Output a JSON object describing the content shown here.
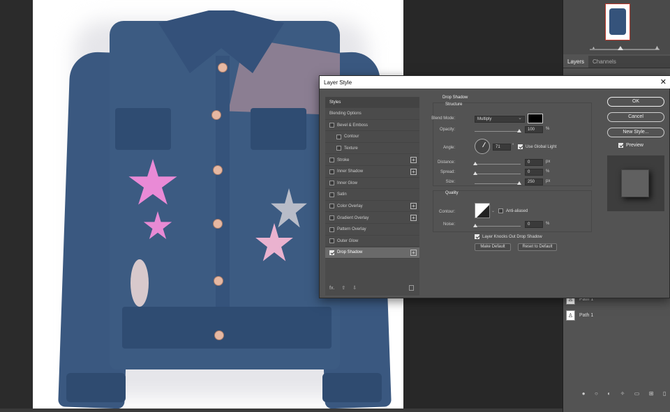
{
  "panels": {
    "tabs": [
      "Layers",
      "Channels"
    ],
    "layers": [
      {
        "name": "Path 1"
      },
      {
        "name": "Path 1"
      }
    ],
    "footer_icons": [
      "link-icon",
      "fx-icon",
      "mask-icon",
      "adjustment-icon",
      "folder-icon",
      "new-layer-icon",
      "trash-icon"
    ]
  },
  "dialog": {
    "title": "Layer Style",
    "close_label": "✕",
    "styles_header": "Styles",
    "styles": [
      {
        "label": "Blending Options",
        "checkbox": false,
        "checked": false,
        "plus": false,
        "indent": false
      },
      {
        "label": "Bevel & Emboss",
        "checkbox": true,
        "checked": false,
        "plus": false,
        "indent": false
      },
      {
        "label": "Contour",
        "checkbox": true,
        "checked": false,
        "plus": false,
        "indent": true
      },
      {
        "label": "Texture",
        "checkbox": true,
        "checked": false,
        "plus": false,
        "indent": true
      },
      {
        "label": "Stroke",
        "checkbox": true,
        "checked": false,
        "plus": true,
        "indent": false
      },
      {
        "label": "Inner Shadow",
        "checkbox": true,
        "checked": false,
        "plus": true,
        "indent": false
      },
      {
        "label": "Inner Glow",
        "checkbox": true,
        "checked": false,
        "plus": false,
        "indent": false
      },
      {
        "label": "Satin",
        "checkbox": true,
        "checked": false,
        "plus": false,
        "indent": false
      },
      {
        "label": "Color Overlay",
        "checkbox": true,
        "checked": false,
        "plus": true,
        "indent": false
      },
      {
        "label": "Gradient Overlay",
        "checkbox": true,
        "checked": false,
        "plus": true,
        "indent": false
      },
      {
        "label": "Pattern Overlay",
        "checkbox": true,
        "checked": false,
        "plus": false,
        "indent": false
      },
      {
        "label": "Outer Glow",
        "checkbox": true,
        "checked": false,
        "plus": false,
        "indent": false
      },
      {
        "label": "Drop Shadow",
        "checkbox": true,
        "checked": true,
        "plus": true,
        "indent": false
      }
    ],
    "fx_label": "fx.",
    "section_title": "Drop Shadow",
    "structure_title": "Structure",
    "blend_mode_label": "Blend Mode:",
    "blend_mode_value": "Multiply",
    "shadow_color": "#000000",
    "opacity_label": "Opacity:",
    "opacity_value": "100",
    "angle_label": "Angle:",
    "angle_value": "71",
    "use_global_light_label": "Use Global Light",
    "use_global_light_checked": true,
    "distance_label": "Distance:",
    "distance_value": "0",
    "spread_label": "Spread:",
    "spread_value": "0",
    "size_label": "Size:",
    "size_value": "250",
    "percent_unit": "%",
    "px_unit": "px",
    "degree_unit": "°",
    "quality_title": "Quality",
    "contour_label": "Contour:",
    "anti_aliased_label": "Anti-aliased",
    "noise_label": "Noise:",
    "noise_value": "0",
    "knockout_label": "Layer Knocks Out Drop Shadow",
    "make_default_label": "Make Default",
    "reset_default_label": "Reset to Default",
    "ok_label": "OK",
    "cancel_label": "Cancel",
    "new_style_label": "New Style...",
    "preview_label": "Preview",
    "preview_checked": true
  }
}
